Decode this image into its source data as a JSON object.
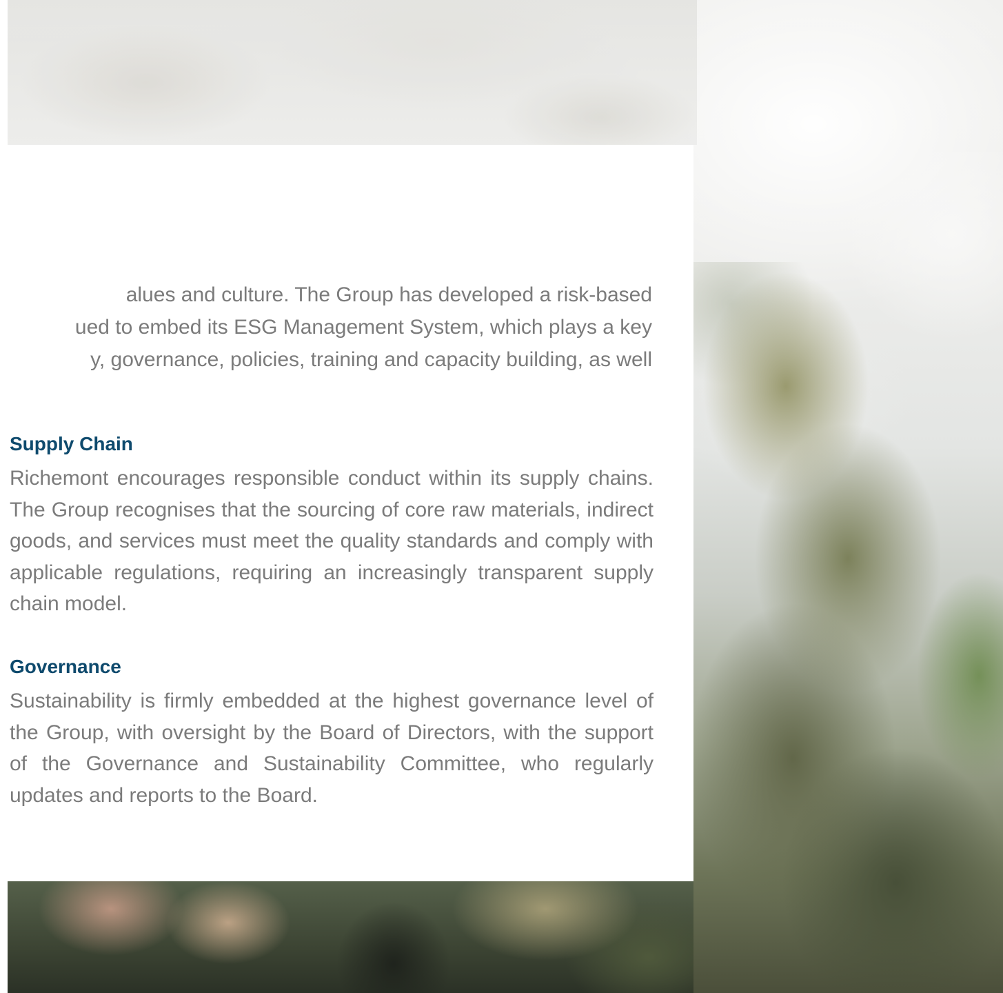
{
  "intro": {
    "lines": [
      "alues and culture. The Group has developed a risk-based",
      "ued to embed its ESG Management System, which plays a key",
      "y, governance, policies, training and capacity building, as well"
    ]
  },
  "sections": [
    {
      "title": "Supply Chain",
      "body": "Richemont encourages responsible conduct within its supply chains. The Group recognises that the sourcing of core raw materials, indirect goods, and services must meet the quality standards and comply with applicable regulations, requiring an increasingly transparent supply chain model."
    },
    {
      "title": "Governance",
      "body": "Sustainability is firmly embedded at the highest governance level of the Group, with oversight by the Board of Directors, with the support of the Governance and Sustainability Committee, who regularly updates and reports to the Board."
    }
  ],
  "colors": {
    "heading": "#0e4a6d",
    "body_text": "#7b7b7b",
    "card_background": "#ffffff"
  }
}
